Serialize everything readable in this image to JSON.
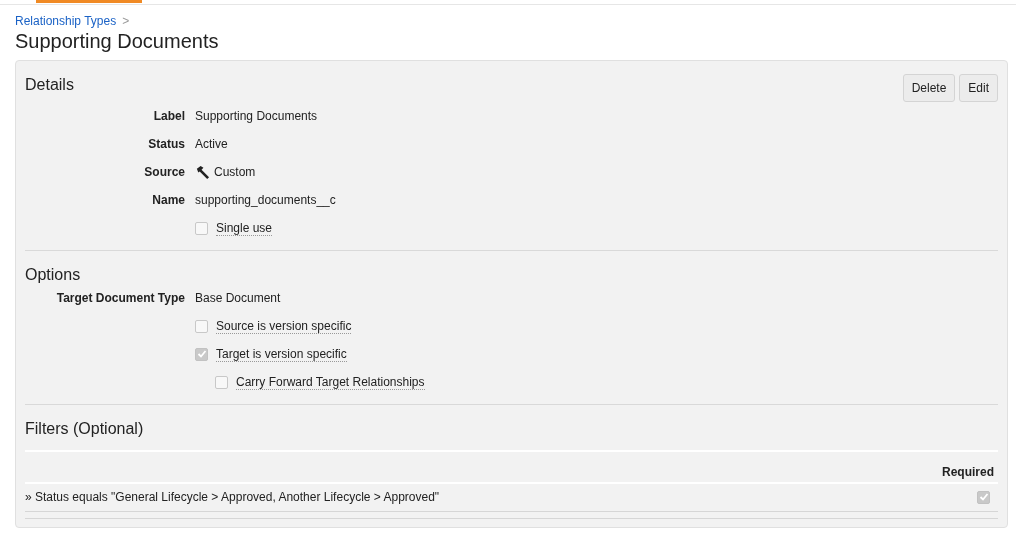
{
  "breadcrumb": {
    "link": "Relationship Types",
    "separator": ">"
  },
  "title": "Supporting Documents",
  "details": {
    "heading": "Details",
    "buttons": [
      "Delete",
      "Edit"
    ],
    "fields": [
      {
        "label": "Label",
        "value": "Supporting Documents",
        "kind": "text"
      },
      {
        "label": "Status",
        "value": "Active",
        "kind": "text"
      },
      {
        "label": "Source",
        "value": "Custom",
        "kind": "icon_text"
      },
      {
        "label": "Name",
        "value": "supporting_documents__c",
        "kind": "text"
      }
    ],
    "checkboxes": [
      {
        "label": "Single use",
        "checked": false
      }
    ]
  },
  "options": {
    "heading": "Options",
    "fields": [
      {
        "label": "Target Document Type",
        "value": "Base Document",
        "kind": "text"
      }
    ],
    "checkboxes": [
      {
        "label": "Source is version specific",
        "checked": false
      },
      {
        "label": "Target is version specific",
        "checked": true,
        "children": [
          {
            "label": "Carry Forward Target Relationships",
            "checked": false
          }
        ]
      }
    ]
  },
  "filters": {
    "heading": "Filters (Optional)",
    "required_header": "Required",
    "rows": [
      {
        "text": "» Status equals \"General Lifecycle > Approved, Another Lifecycle > Approved\"",
        "required": true
      }
    ]
  }
}
